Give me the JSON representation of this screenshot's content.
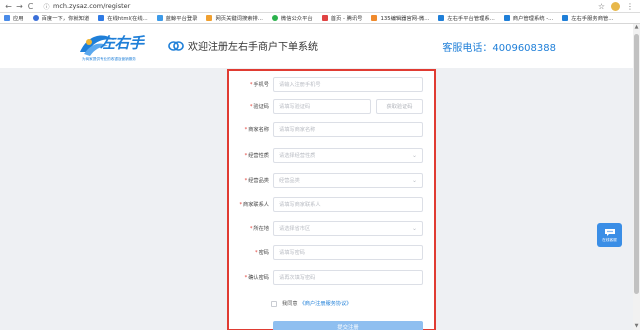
{
  "browser": {
    "url": "mch.zysaz.com/register",
    "nav": {
      "back": "←",
      "forward": "→",
      "reload": "C"
    },
    "star": "☆",
    "menu": "⋮"
  },
  "bookmarks": [
    {
      "label": "应用",
      "color": "#4a8be8"
    },
    {
      "label": "百度一下，你就知道",
      "color": "#3a6fd8"
    },
    {
      "label": "在线html(在线...",
      "color": "#2f7ae5"
    },
    {
      "label": "蓝鲸平台登录",
      "color": "#3d9be9"
    },
    {
      "label": "网页关键词搜索排...",
      "color": "#f0a030"
    },
    {
      "label": "微信公众平台",
      "color": "#2bb24c"
    },
    {
      "label": "首页 - 腾讯号",
      "color": "#e04343"
    },
    {
      "label": "135编辑器官网-微...",
      "color": "#f08a2c"
    },
    {
      "label": "左右手平台管理系...",
      "color": "#1f7fd8"
    },
    {
      "label": "商户管理系统 -...",
      "color": "#1f7fd8"
    },
    {
      "label": "左右手服务商管...",
      "color": "#1f7fd8"
    }
  ],
  "header": {
    "logo_text": "左右手",
    "logo_sub": "为商家提供专业的收银及营销服务",
    "welcome": "欢迎注册左右手商户下单系统",
    "hotline": "客服电话：4009608388"
  },
  "form": {
    "phone": {
      "label": "手机号",
      "placeholder": "请输入注册手机号"
    },
    "code": {
      "label": "验证码",
      "placeholder": "请填写验证码",
      "button": "获取验证码"
    },
    "merchant_name": {
      "label": "商家名称",
      "placeholder": "请填写商家名称"
    },
    "business_nature": {
      "label": "经营性质",
      "placeholder": "请选择经营性质"
    },
    "business_category": {
      "label": "经营品类",
      "placeholder": "经营品类"
    },
    "contact": {
      "label": "商家联系人",
      "placeholder": "请填写商家联系人"
    },
    "region": {
      "label": "所在地",
      "placeholder": "请选择省市区"
    },
    "password": {
      "label": "密码",
      "placeholder": "请填写密码"
    },
    "confirm_password": {
      "label": "确认密码",
      "placeholder": "请再次填写密码"
    },
    "required_mark": "*",
    "agree_text": "我同意",
    "agree_link": "《商户注册服务协议》",
    "submit": "提交注册"
  },
  "service": {
    "label": "在线客服"
  },
  "colors": {
    "accent": "#1f7fd8",
    "highlight_border": "#e03b32",
    "submit_bg": "#8fbff0"
  }
}
